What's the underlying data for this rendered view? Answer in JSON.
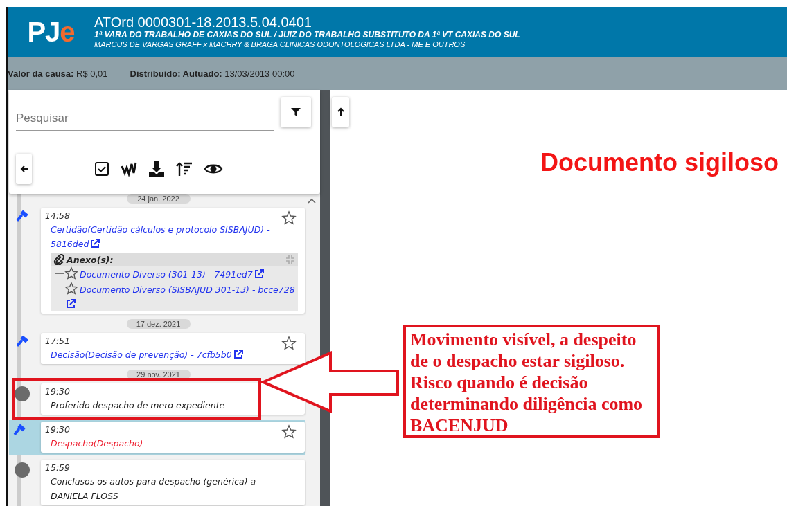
{
  "header": {
    "logo": {
      "main": "PJ",
      "accent": "e"
    },
    "case_number": "ATOrd 0000301-18.2013.5.04.0401",
    "court": "1ª VARA DO TRABALHO DE CAXIAS DO SUL / JUIZ DO TRABALHO SUBSTITUTO DA 1ª VT CAXIAS DO SUL",
    "parties": "MARCUS DE VARGAS GRAFF x MACHRY & BRAGA CLINICAS ODONTOLOGICAS LTDA - ME E OUTROS"
  },
  "info_bar": [
    {
      "label": "Valor da causa:",
      "value": "R$ 0,01"
    },
    {
      "label": "Distribuído: Autuado:",
      "value": "13/03/2013 00:00"
    }
  ],
  "search": {
    "placeholder": "Pesquisar"
  },
  "timeline": [
    {
      "kind": "date",
      "label": "24 jan. 2022"
    },
    {
      "kind": "document",
      "time": "14:58",
      "title": "Certidão(Certidão cálculos e protocolo SISBAJUD) - 5816ded",
      "selected": false,
      "external_link": true,
      "attachments": {
        "label": "Anexo(s):",
        "items": [
          "Documento Diverso (301-13) - 7491ed7",
          "Documento Diverso (SISBAJUD 301-13) - bcce728"
        ]
      }
    },
    {
      "kind": "date",
      "label": "17 dez. 2021"
    },
    {
      "kind": "document",
      "time": "17:51",
      "title": "Decisão(Decisão de prevenção) - 7cfb5b0",
      "selected": false,
      "external_link": true
    },
    {
      "kind": "date",
      "label": "29 nov. 2021"
    },
    {
      "kind": "movement",
      "time": "19:30",
      "title": "Proferido despacho de mero expediente",
      "selected": false,
      "highlighted": true
    },
    {
      "kind": "document",
      "time": "19:30",
      "title": "Despacho(Despacho)",
      "selected": true
    },
    {
      "kind": "movement",
      "time": "15:59",
      "title": "Conclusos os autos para despacho (genérica) a DANIELA FLOSS",
      "selected": false
    }
  ],
  "viewer": {
    "message": "Documento sigiloso"
  },
  "annotation": {
    "text": "Movimento visível, a despeito de o despacho estar sigiloso. Risco quando é decisão determinando diligência como BACENJUD"
  }
}
